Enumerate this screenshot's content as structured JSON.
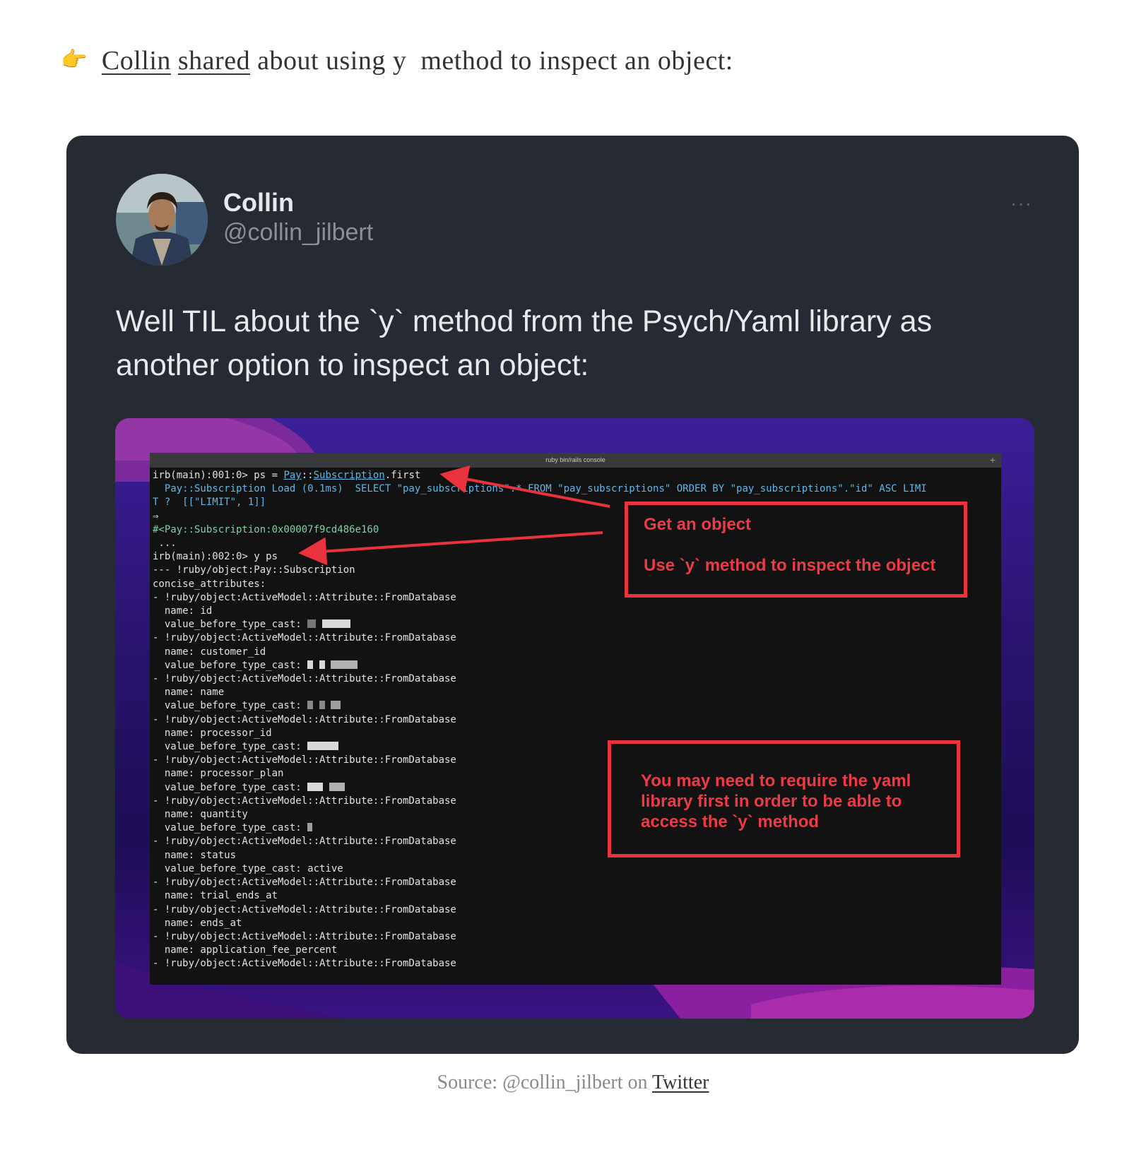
{
  "intro": {
    "icon": "pointing-right-hand-icon",
    "author_link": "Collin",
    "shared_link": "shared",
    "text_before_code": "about using",
    "code": "y",
    "text_after_code": "method to inspect an object:"
  },
  "tweet": {
    "author_name": "Collin",
    "author_handle": "@collin_jilbert",
    "more_label": "···",
    "text": "Well TIL about the `y` method from the Psych/Yaml library as another option to inspect an object:"
  },
  "terminal": {
    "title": "ruby bin/rails console",
    "plus": "+",
    "lines": {
      "l1_prompt": "irb(main):001:0> ps = ",
      "l1_pay": "Pay",
      "l1_sep": "::",
      "l1_sub": "Subscription",
      "l1_tail": ".first",
      "l2": "  Pay::Subscription Load (0.1ms)  SELECT \"pay_subscriptions\".* FROM \"pay_subscriptions\" ORDER BY \"pay_subscriptions\".\"id\" ASC LIMI",
      "l3": "T ?  [[\"LIMIT\", 1]]",
      "l4": "⇒",
      "l5": "#<Pay::Subscription:0x00007f9cd486e160",
      "l6": " ...",
      "l7": "irb(main):002:0> y ps",
      "l8": "--- !ruby/object:Pay::Subscription",
      "l9": "concise_attributes:",
      "attr": "- !ruby/object:ActiveModel::Attribute::FromDatabase",
      "name_id": "  name: id",
      "vbtc": "  value_before_type_cast: ",
      "name_customer_id": "  name: customer_id",
      "name_name": "  name: name",
      "name_processor_id": "  name: processor_id",
      "name_processor_plan": "  name: processor_plan",
      "name_quantity": "  name: quantity",
      "name_status": "  name: status",
      "vbtc_active": "  value_before_type_cast: active",
      "name_trial_ends_at": "  name: trial_ends_at",
      "name_ends_at": "  name: ends_at",
      "name_application_fee_percent": "  name: application_fee_percent"
    }
  },
  "annotations": {
    "box1_line1": "Get an object",
    "box1_line2": "Use `y` method to inspect the object",
    "box2_text": "You may need to require the yaml library first in order to be able to access the `y` method",
    "color": "#e8323c"
  },
  "source": {
    "prefix": "Source: @collin_jilbert on",
    "link": "Twitter"
  }
}
